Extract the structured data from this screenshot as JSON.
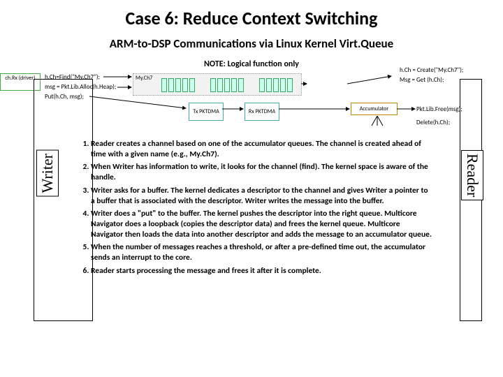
{
  "title": "Case 6: Reduce Context Switching",
  "subtitle": "ARM-to-DSP Communications via Linux Kernel Virt.Queue",
  "note": "NOTE: Logical function only",
  "writer_ops": {
    "find": "h.Ch=Find(\"My.Ch7\");",
    "alloc": "msg = Pkt.Lib.Alloc(h.Heap);",
    "put": "Put(h.Ch, msg);"
  },
  "reader_ops": {
    "create": "h.Ch = Create(\"My.Ch7\");",
    "get": "Msg = Get (h.Ch);",
    "free": "Pkt.Lib.Free(msg);",
    "del": "Delete(h.Ch);"
  },
  "chip_label": "My.Ch7",
  "rx_label": "ch.Rx (driver)",
  "tx_pktdma": "Tx PKTDMA",
  "rx_pktdma": "Rx PKTDMA",
  "acc": "Accumulator",
  "vert_writer": "Writer",
  "vert_reader": "Reader",
  "steps": [
    "Reader creates a channel based on one of the accumulator queues. The channel is created ahead of time with a given name (e.g., My.Ch7).",
    "When Writer has information to write, it looks for the channel (find). The kernel space is aware of the handle.",
    "Writer asks for a buffer. The kernel dedicates a descriptor to the channel and gives Writer a pointer to a buffer that is associated with the descriptor. Writer writes the message into the buffer.",
    "Writer does a \"put\" to the buffer. The kernel pushes the descriptor into the right queue. Multicore Navigator does a loopback (copies the descriptor data) and frees the kernel queue. Multicore Navigator then loads the data into another descriptor and adds the message to an accumulator queue.",
    "When the number of messages reaches a threshold, or after a pre-defined time out, the accumulator sends an interrupt to the core.",
    "Reader starts processing the message and frees it after it is complete."
  ]
}
